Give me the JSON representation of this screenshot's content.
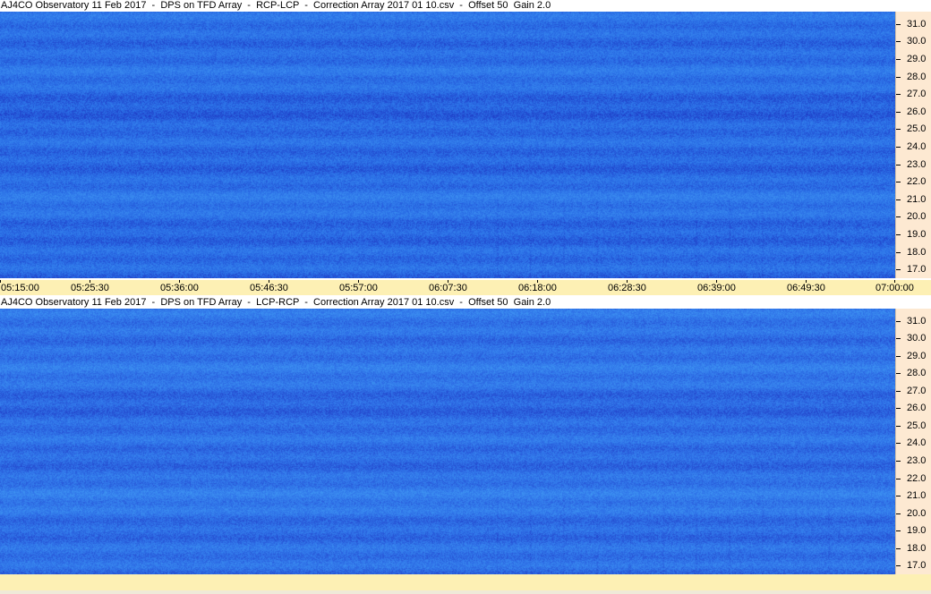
{
  "chart_data": [
    {
      "type": "heatmap",
      "title": "AJ4CO Observatory 11 Feb 2017  -  DPS on TFD Array  -  RCP-LCP  -  Correction Array 2017 01 10.csv  -  Offset 50  Gain 2.0",
      "y_ticks": [
        "31.0",
        "30.0",
        "29.0",
        "28.0",
        "27.0",
        "26.0",
        "25.0",
        "24.0",
        "23.0",
        "22.0",
        "21.0",
        "20.0",
        "19.0",
        "18.0",
        "17.0"
      ],
      "y_range": [
        16.5,
        31.7
      ],
      "x_ticks": [
        "05:15:00",
        "05:25:30",
        "05:36:00",
        "05:46:30",
        "05:57:00",
        "06:07:30",
        "06:18:00",
        "06:28:30",
        "06:39:00",
        "06:49:30",
        "07:00:00"
      ],
      "x_range": [
        "05:15:00",
        "07:00:00"
      ],
      "colors": {
        "base": "#2a6ee6",
        "dark": "#1f3fc8",
        "light": "#3a8cf0"
      }
    },
    {
      "type": "heatmap",
      "title": "AJ4CO Observatory 11 Feb 2017  -  DPS on TFD Array  -  LCP-RCP  -  Correction Array 2017 01 10.csv  -  Offset 50  Gain 2.0",
      "y_ticks": [
        "31.0",
        "30.0",
        "29.0",
        "28.0",
        "27.0",
        "26.0",
        "25.0",
        "24.0",
        "23.0",
        "22.0",
        "21.0",
        "20.0",
        "19.0",
        "18.0",
        "17.0"
      ],
      "y_range": [
        16.5,
        31.7
      ],
      "x_ticks": [],
      "x_range": [
        "05:15:00",
        "07:00:00"
      ],
      "colors": {
        "base": "#2f72e8",
        "dark": "#2346cc",
        "light": "#3d92f2"
      }
    }
  ],
  "ui": {
    "axis_bg": "#fde9d2",
    "time_axis_bg": "#fdf0b4"
  }
}
